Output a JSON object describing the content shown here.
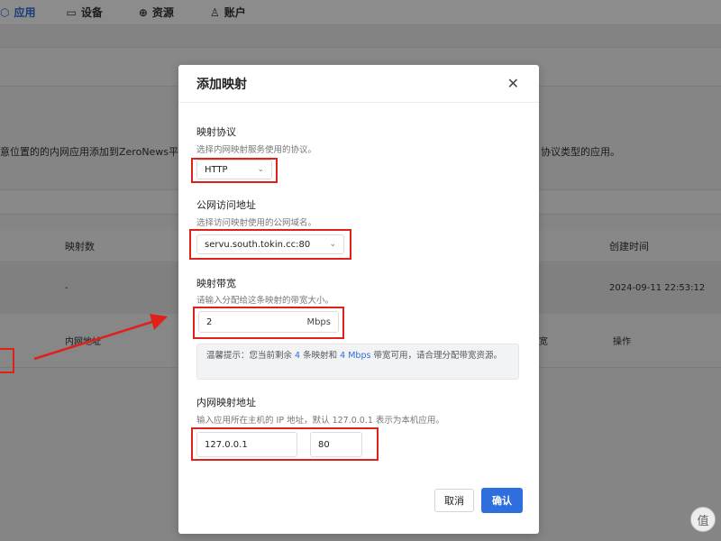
{
  "nav": {
    "items": [
      {
        "label": "应用",
        "icon": "cube-icon",
        "active": true
      },
      {
        "label": "设备",
        "icon": "laptop-icon",
        "active": false
      },
      {
        "label": "资源",
        "icon": "globe-icon",
        "active": false
      },
      {
        "label": "账户",
        "icon": "user-icon",
        "active": false
      }
    ]
  },
  "background": {
    "description_left": "意位置的的内网应用添加到ZeroNews平",
    "description_right": "协议类型的应用。",
    "table_headers": [
      "映射数",
      "创建时间"
    ],
    "row1": {
      "mapping_count": "-",
      "created_at": "2024-09-11 22:53:12"
    },
    "row2": {
      "mapping_count": "内网地址",
      "col_a": "宽",
      "action": "操作"
    }
  },
  "modal": {
    "title": "添加映射",
    "protocol": {
      "label": "映射协议",
      "hint": "选择内网映射服务使用的协议。",
      "value": "HTTP"
    },
    "domain": {
      "label": "公网访问地址",
      "hint": "选择访问映射使用的公网域名。",
      "value": "servu.south.tokin.cc:80"
    },
    "bandwidth": {
      "label": "映射带宽",
      "hint": "请输入分配给这条映射的带宽大小。",
      "value": "2",
      "unit": "Mbps"
    },
    "tip": {
      "prefix": "温馨提示：您当前剩余",
      "count": "4",
      "middle": "条映射和",
      "bandwidth": "4 Mbps",
      "suffix": "带宽可用，请合理分配带宽资源。"
    },
    "internal": {
      "label": "内网映射地址",
      "hint": "输入应用所在主机的 IP 地址，默认 127.0.0.1 表示为本机应用。",
      "ip": "127.0.0.1",
      "port": "80"
    },
    "cancel_label": "取消",
    "ok_label": "确认"
  },
  "watermark": "值",
  "colors": {
    "accent": "#2f6fdd",
    "annotation": "#e0201b"
  }
}
